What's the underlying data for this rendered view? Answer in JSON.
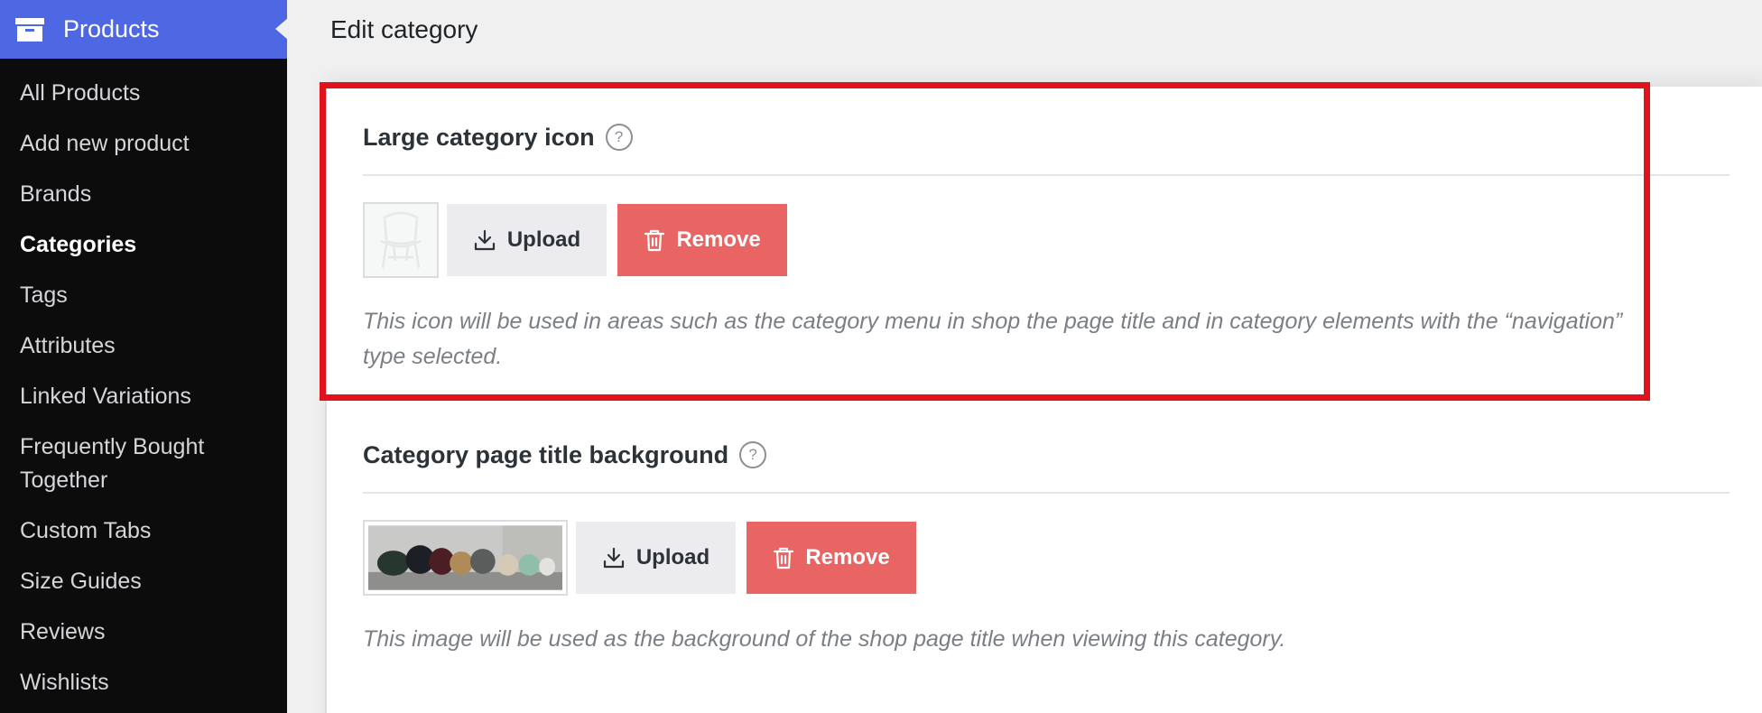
{
  "sidebar": {
    "title": "Products",
    "title_icon": "archive-box-icon",
    "items": [
      {
        "label": "All Products"
      },
      {
        "label": "Add new product"
      },
      {
        "label": "Brands"
      },
      {
        "label": "Categories",
        "active": true
      },
      {
        "label": "Tags"
      },
      {
        "label": "Attributes"
      },
      {
        "label": "Linked Variations"
      },
      {
        "label": "Frequently Bought Together"
      },
      {
        "label": "Custom Tabs"
      },
      {
        "label": "Size Guides"
      },
      {
        "label": "Reviews"
      },
      {
        "label": "Wishlists"
      }
    ]
  },
  "header": {
    "title": "Edit category"
  },
  "sections": {
    "large_icon": {
      "title": "Large category icon",
      "help": "?",
      "upload_label": "Upload",
      "remove_label": "Remove",
      "description": "This icon will be used in areas such as the category menu in shop the page title and in category elements with the “navigation” type selected."
    },
    "title_background": {
      "title": "Category page title background",
      "help": "?",
      "upload_label": "Upload",
      "remove_label": "Remove",
      "description": "This image will be used as the background of the shop page title when viewing this category."
    }
  },
  "colors": {
    "sidebar_bg": "#0c0c0d",
    "sidebar_header": "#4e68e3",
    "remove_button": "#e96564",
    "upload_button": "#ececee",
    "highlight_border": "#e0121b"
  }
}
